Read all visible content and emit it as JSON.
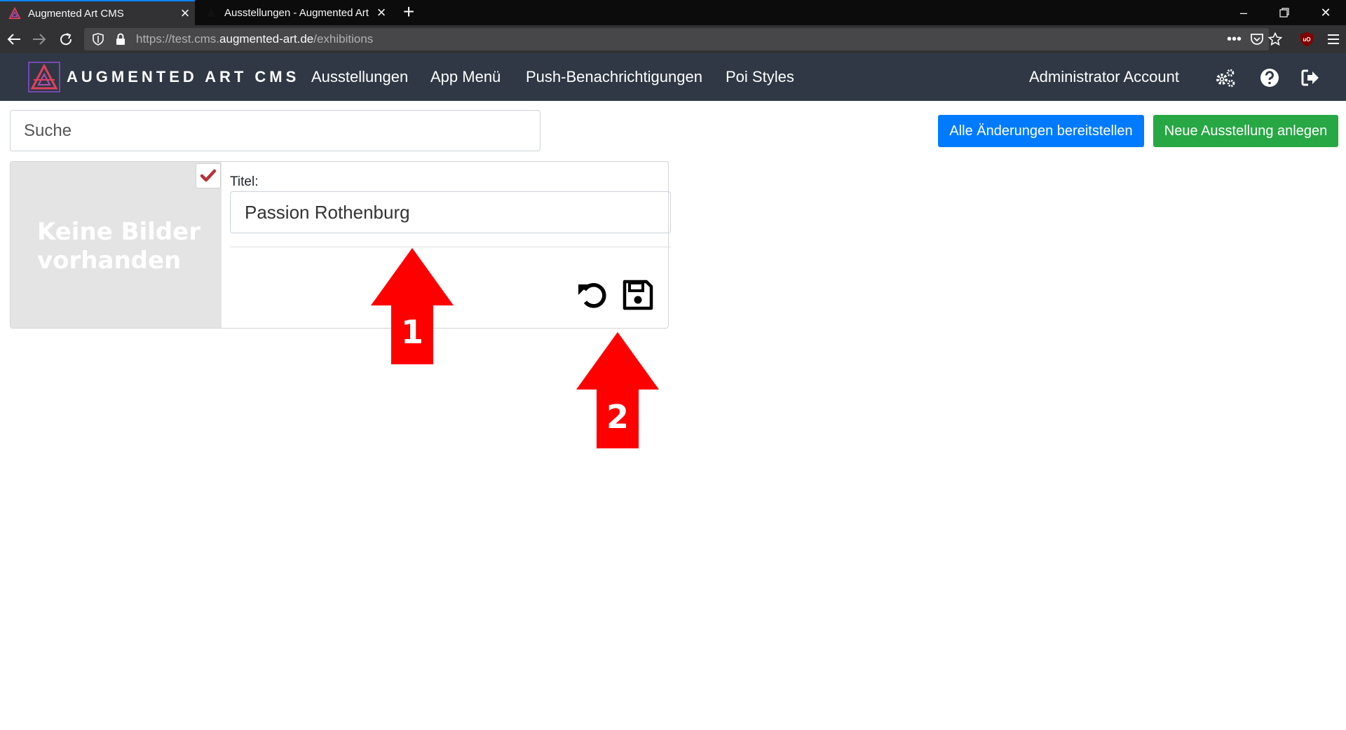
{
  "browser": {
    "tabs": [
      {
        "title": "Augmented Art CMS",
        "active": true
      },
      {
        "title": "Ausstellungen - Augmented Art",
        "active": false
      }
    ],
    "url_prefix": "https://test.cms.",
    "url_host": "augmented-art.de",
    "url_path": "/exhibitions"
  },
  "header": {
    "brand": "AUGMENTED ART CMS",
    "nav": [
      "Ausstellungen",
      "App Menü",
      "Push-Benachrichtigungen",
      "Poi Styles"
    ],
    "account": "Administrator Account",
    "icons": [
      "cogs-icon",
      "question-circle-icon",
      "sign-out-icon"
    ]
  },
  "toolbar": {
    "search_placeholder": "Suche",
    "deploy_label": "Alle Änderungen bereitstellen",
    "new_label": "Neue Ausstellung anlegen"
  },
  "exhibition": {
    "no_images": "Keine Bilder vorhanden",
    "title_label": "Titel:",
    "title_value": "Passion Rothenburg",
    "checked": true
  },
  "annotations": [
    {
      "label": "1"
    },
    {
      "label": "2"
    }
  ],
  "colors": {
    "navbar": "#2f3844",
    "primary": "#007bff",
    "success": "#28a745",
    "annotation": "#ff0000",
    "check": "#b8313a"
  }
}
